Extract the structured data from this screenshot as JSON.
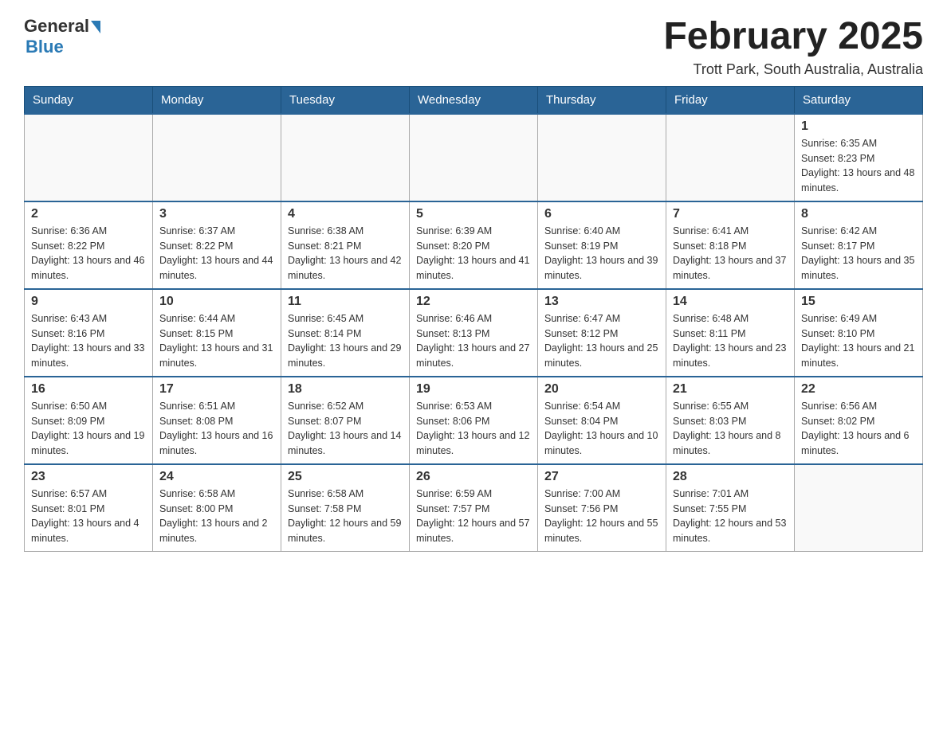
{
  "header": {
    "logo": {
      "general": "General",
      "blue": "Blue"
    },
    "title": "February 2025",
    "location": "Trott Park, South Australia, Australia"
  },
  "days_of_week": [
    "Sunday",
    "Monday",
    "Tuesday",
    "Wednesday",
    "Thursday",
    "Friday",
    "Saturday"
  ],
  "weeks": [
    {
      "days": [
        {
          "number": "",
          "info": ""
        },
        {
          "number": "",
          "info": ""
        },
        {
          "number": "",
          "info": ""
        },
        {
          "number": "",
          "info": ""
        },
        {
          "number": "",
          "info": ""
        },
        {
          "number": "",
          "info": ""
        },
        {
          "number": "1",
          "info": "Sunrise: 6:35 AM\nSunset: 8:23 PM\nDaylight: 13 hours and 48 minutes."
        }
      ]
    },
    {
      "days": [
        {
          "number": "2",
          "info": "Sunrise: 6:36 AM\nSunset: 8:22 PM\nDaylight: 13 hours and 46 minutes."
        },
        {
          "number": "3",
          "info": "Sunrise: 6:37 AM\nSunset: 8:22 PM\nDaylight: 13 hours and 44 minutes."
        },
        {
          "number": "4",
          "info": "Sunrise: 6:38 AM\nSunset: 8:21 PM\nDaylight: 13 hours and 42 minutes."
        },
        {
          "number": "5",
          "info": "Sunrise: 6:39 AM\nSunset: 8:20 PM\nDaylight: 13 hours and 41 minutes."
        },
        {
          "number": "6",
          "info": "Sunrise: 6:40 AM\nSunset: 8:19 PM\nDaylight: 13 hours and 39 minutes."
        },
        {
          "number": "7",
          "info": "Sunrise: 6:41 AM\nSunset: 8:18 PM\nDaylight: 13 hours and 37 minutes."
        },
        {
          "number": "8",
          "info": "Sunrise: 6:42 AM\nSunset: 8:17 PM\nDaylight: 13 hours and 35 minutes."
        }
      ]
    },
    {
      "days": [
        {
          "number": "9",
          "info": "Sunrise: 6:43 AM\nSunset: 8:16 PM\nDaylight: 13 hours and 33 minutes."
        },
        {
          "number": "10",
          "info": "Sunrise: 6:44 AM\nSunset: 8:15 PM\nDaylight: 13 hours and 31 minutes."
        },
        {
          "number": "11",
          "info": "Sunrise: 6:45 AM\nSunset: 8:14 PM\nDaylight: 13 hours and 29 minutes."
        },
        {
          "number": "12",
          "info": "Sunrise: 6:46 AM\nSunset: 8:13 PM\nDaylight: 13 hours and 27 minutes."
        },
        {
          "number": "13",
          "info": "Sunrise: 6:47 AM\nSunset: 8:12 PM\nDaylight: 13 hours and 25 minutes."
        },
        {
          "number": "14",
          "info": "Sunrise: 6:48 AM\nSunset: 8:11 PM\nDaylight: 13 hours and 23 minutes."
        },
        {
          "number": "15",
          "info": "Sunrise: 6:49 AM\nSunset: 8:10 PM\nDaylight: 13 hours and 21 minutes."
        }
      ]
    },
    {
      "days": [
        {
          "number": "16",
          "info": "Sunrise: 6:50 AM\nSunset: 8:09 PM\nDaylight: 13 hours and 19 minutes."
        },
        {
          "number": "17",
          "info": "Sunrise: 6:51 AM\nSunset: 8:08 PM\nDaylight: 13 hours and 16 minutes."
        },
        {
          "number": "18",
          "info": "Sunrise: 6:52 AM\nSunset: 8:07 PM\nDaylight: 13 hours and 14 minutes."
        },
        {
          "number": "19",
          "info": "Sunrise: 6:53 AM\nSunset: 8:06 PM\nDaylight: 13 hours and 12 minutes."
        },
        {
          "number": "20",
          "info": "Sunrise: 6:54 AM\nSunset: 8:04 PM\nDaylight: 13 hours and 10 minutes."
        },
        {
          "number": "21",
          "info": "Sunrise: 6:55 AM\nSunset: 8:03 PM\nDaylight: 13 hours and 8 minutes."
        },
        {
          "number": "22",
          "info": "Sunrise: 6:56 AM\nSunset: 8:02 PM\nDaylight: 13 hours and 6 minutes."
        }
      ]
    },
    {
      "days": [
        {
          "number": "23",
          "info": "Sunrise: 6:57 AM\nSunset: 8:01 PM\nDaylight: 13 hours and 4 minutes."
        },
        {
          "number": "24",
          "info": "Sunrise: 6:58 AM\nSunset: 8:00 PM\nDaylight: 13 hours and 2 minutes."
        },
        {
          "number": "25",
          "info": "Sunrise: 6:58 AM\nSunset: 7:58 PM\nDaylight: 12 hours and 59 minutes."
        },
        {
          "number": "26",
          "info": "Sunrise: 6:59 AM\nSunset: 7:57 PM\nDaylight: 12 hours and 57 minutes."
        },
        {
          "number": "27",
          "info": "Sunrise: 7:00 AM\nSunset: 7:56 PM\nDaylight: 12 hours and 55 minutes."
        },
        {
          "number": "28",
          "info": "Sunrise: 7:01 AM\nSunset: 7:55 PM\nDaylight: 12 hours and 53 minutes."
        },
        {
          "number": "",
          "info": ""
        }
      ]
    }
  ]
}
